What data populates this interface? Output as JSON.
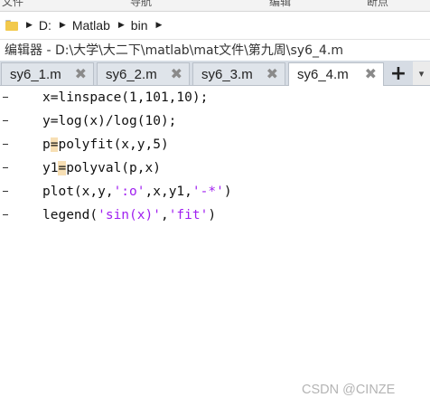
{
  "menu": {
    "items": [
      "文件",
      "导航",
      "编辑",
      "断点"
    ]
  },
  "path": {
    "segments": [
      "D:",
      "Matlab",
      "bin"
    ]
  },
  "window": {
    "title": "编辑器 - D:\\大学\\大二下\\matlab\\mat文件\\第九周\\sy6_4.m"
  },
  "tabs": [
    {
      "label": "sy6_1.m",
      "close": "✖",
      "active": false
    },
    {
      "label": "sy6_2.m",
      "close": "✖",
      "active": false
    },
    {
      "label": "sy6_3.m",
      "close": "✖",
      "active": false
    },
    {
      "label": "sy6_4.m",
      "close": "✖",
      "active": true
    }
  ],
  "new_tab_label": "+",
  "code": {
    "line1": {
      "a": "x=linspace(1,101,10);"
    },
    "line2": {
      "a": "y=log(x)/log(10);"
    },
    "line3": {
      "a": "p",
      "h": "=",
      "b": "polyfit(x,y,5)"
    },
    "line4": {
      "a": "y1",
      "h": "=",
      "b": "polyval(p,x)"
    },
    "line5": {
      "a": "plot(x,y,",
      "s1": "':o'",
      "m": ",x,y1,",
      "s2": "'-*'",
      "e": ")"
    },
    "line6": {
      "a": "legend(",
      "s1": "'sin(x)'",
      "m": ",",
      "s2": "'fit'",
      "e": ")"
    }
  },
  "watermark": "CSDN @CINZE",
  "colors": {
    "string": "#a020f0",
    "highlight": "#f7dfb4",
    "tabbar": "#d6dce4",
    "folder": "#f2c94c"
  },
  "icons": [
    "folder-icon",
    "chevron-right-icon",
    "close-icon",
    "plus-icon",
    "chevron-down-icon"
  ]
}
